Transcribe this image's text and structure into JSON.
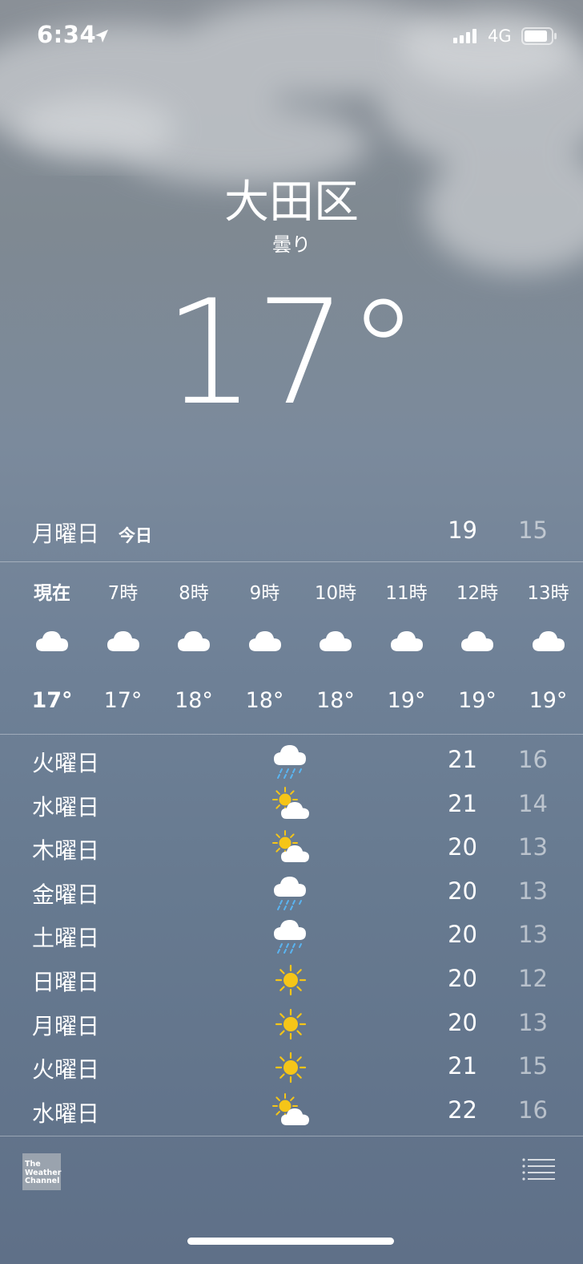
{
  "status_bar": {
    "time": "6:34",
    "network": "4G"
  },
  "header": {
    "city": "大田区",
    "condition": "曇り",
    "temperature": "17°"
  },
  "today": {
    "day": "月曜日",
    "tag": "今日",
    "high": "19",
    "low": "15"
  },
  "hourly": [
    {
      "label": "現在",
      "icon": "cloud-icon",
      "temp": "17°"
    },
    {
      "label": "7時",
      "icon": "cloud-icon",
      "temp": "17°"
    },
    {
      "label": "8時",
      "icon": "cloud-icon",
      "temp": "18°"
    },
    {
      "label": "9時",
      "icon": "cloud-icon",
      "temp": "18°"
    },
    {
      "label": "10時",
      "icon": "cloud-icon",
      "temp": "18°"
    },
    {
      "label": "11時",
      "icon": "cloud-icon",
      "temp": "19°"
    },
    {
      "label": "12時",
      "icon": "cloud-icon",
      "temp": "19°"
    },
    {
      "label": "13時",
      "icon": "cloud-icon",
      "temp": "19°"
    }
  ],
  "daily": [
    {
      "day": "火曜日",
      "icon": "rain-cloud-icon",
      "high": "21",
      "low": "16"
    },
    {
      "day": "水曜日",
      "icon": "partly-sunny-icon",
      "high": "21",
      "low": "14"
    },
    {
      "day": "木曜日",
      "icon": "partly-sunny-icon",
      "high": "20",
      "low": "13"
    },
    {
      "day": "金曜日",
      "icon": "rain-cloud-icon",
      "high": "20",
      "low": "13"
    },
    {
      "day": "土曜日",
      "icon": "rain-cloud-icon",
      "high": "20",
      "low": "13"
    },
    {
      "day": "日曜日",
      "icon": "sun-icon",
      "high": "20",
      "low": "12"
    },
    {
      "day": "月曜日",
      "icon": "sun-icon",
      "high": "20",
      "low": "13"
    },
    {
      "day": "火曜日",
      "icon": "sun-icon",
      "high": "21",
      "low": "15"
    },
    {
      "day": "水曜日",
      "icon": "partly-sunny-icon",
      "high": "22",
      "low": "16"
    }
  ],
  "footer": {
    "logo_text": [
      "The",
      "Weather",
      "Channel"
    ]
  },
  "colors": {
    "sun": "#f5c518",
    "rain": "#5ab4f0",
    "low_temp": "rgba(255,255,255,0.55)"
  }
}
